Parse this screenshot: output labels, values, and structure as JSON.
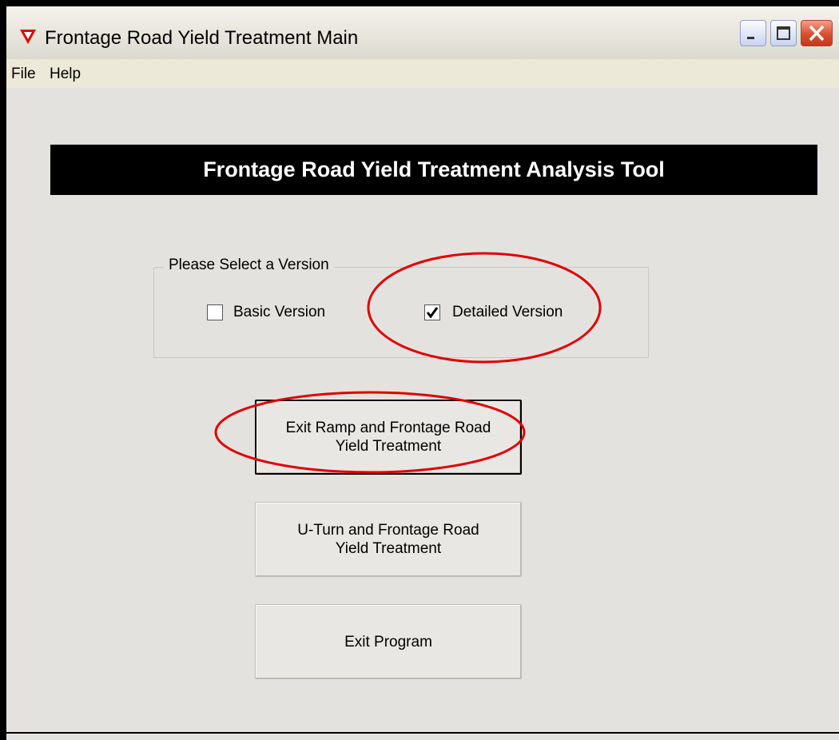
{
  "window": {
    "title": "Frontage Road Yield Treatment Main",
    "icon": "yield-triangle-icon",
    "controls": [
      "minimize-icon",
      "maximize-icon",
      "close-icon"
    ]
  },
  "menu": {
    "items": [
      {
        "label": "File"
      },
      {
        "label": "Help"
      }
    ]
  },
  "banner": {
    "title": "Frontage Road Yield Treatment Analysis Tool"
  },
  "version_group": {
    "legend": "Please Select a Version",
    "basic": {
      "label": "Basic Version",
      "checked": false
    },
    "detailed": {
      "label": "Detailed Version",
      "checked": true
    }
  },
  "buttons": {
    "exit_ramp": "Exit Ramp and Frontage Road\nYield Treatment",
    "u_turn": "U-Turn and Frontage Road\nYield Treatment",
    "exit_program": "Exit Program"
  },
  "colors": {
    "annotation": "#e00000",
    "banner_bg": "#000000",
    "banner_text": "#ffffff",
    "title_icon": "#e00000"
  }
}
